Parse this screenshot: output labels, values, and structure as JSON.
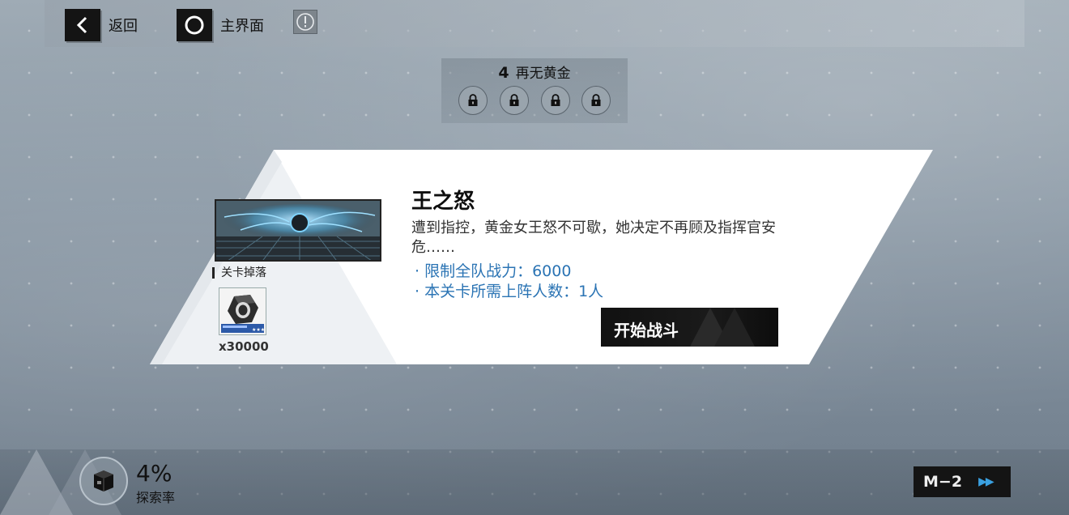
{
  "top_bar": {
    "back_label": "返回",
    "home_label": "主界面"
  },
  "stage_header": {
    "number": "4",
    "title": "再无黄金",
    "locks": [
      "lock-icon",
      "lock-icon",
      "lock-icon",
      "lock-icon"
    ]
  },
  "stage": {
    "name": "王之怒",
    "description": "遭到指控，黄金女王怒不可歇，她决定不再顾及指挥官安危……",
    "requirements": [
      "· 限制全队战力：6000",
      "· 本关卡所需上阵人数：1人"
    ],
    "drop_label": "关卡掉落",
    "drop_quantity": "x30000",
    "start_label": "开始战斗"
  },
  "exploration": {
    "percent": "4%",
    "label": "探索率"
  },
  "map": {
    "code": "M−2"
  },
  "colors": {
    "accent_blue": "#2b74b4",
    "button_dark": "#141414"
  }
}
